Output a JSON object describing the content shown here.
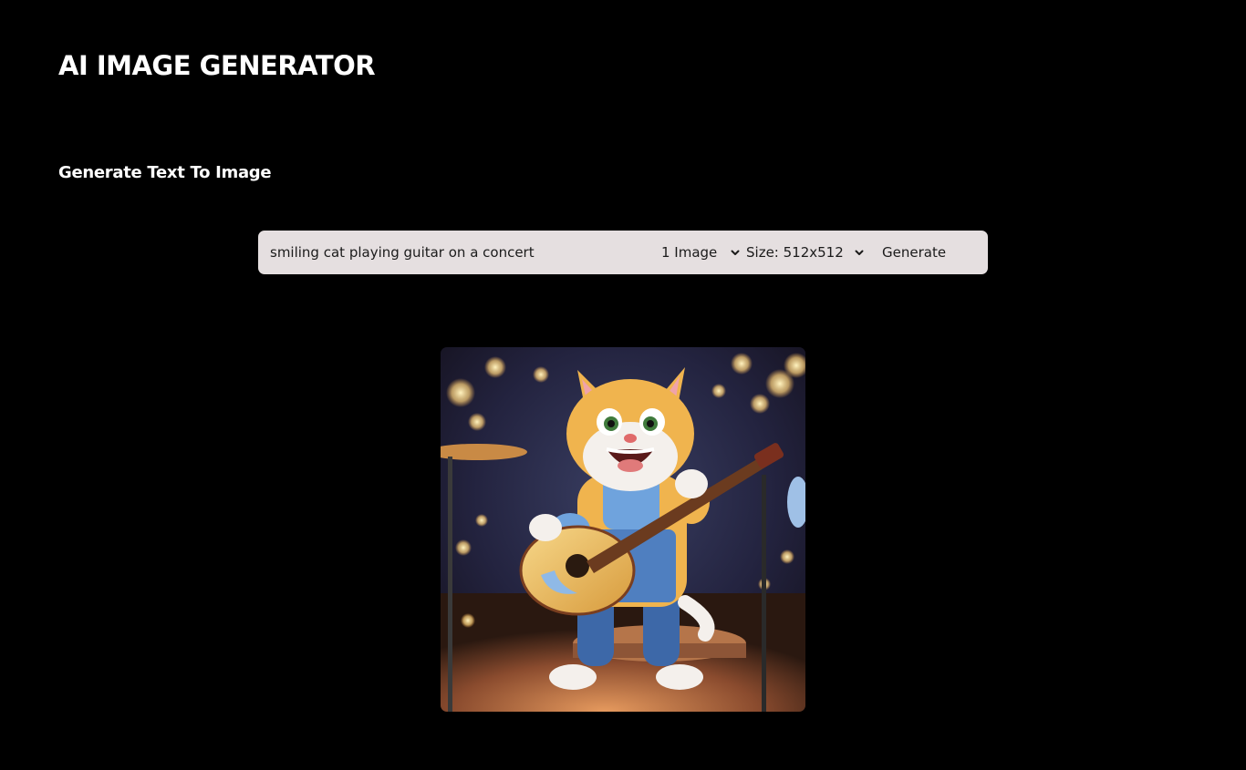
{
  "header": {
    "title": "AI IMAGE GENERATOR"
  },
  "section": {
    "title": "Generate Text To Image"
  },
  "prompt_bar": {
    "prompt_value": "smiling cat playing guitar on a concert",
    "image_count_selected": "1 Image",
    "size_selected": "Size: 512x512",
    "generate_label": "Generate"
  },
  "result": {
    "image_icon": "cartoon-cat-playing-guitar-image"
  },
  "colors": {
    "page_background": "#000000",
    "title_text": "#ffffff",
    "prompt_bar_background": "#e5dfe0",
    "prompt_bar_text": "#1b1b1b"
  }
}
